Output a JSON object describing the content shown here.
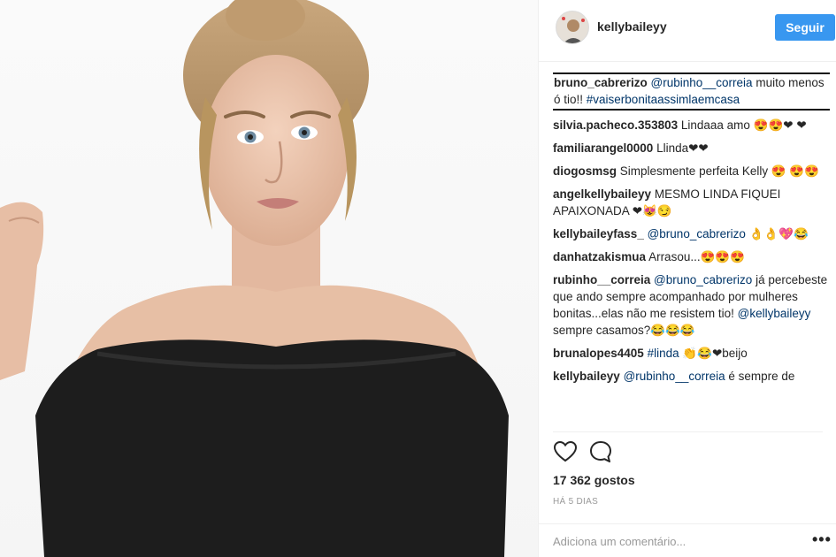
{
  "post": {
    "photo_alt": "Portrait photo",
    "author": {
      "username": "kellybaileyy",
      "follow_label": "Seguir"
    },
    "comments": [
      {
        "user": "bruno_cabrerizo",
        "parts": [
          {
            "type": "h",
            "text": "@rubinho__correia"
          },
          {
            "type": "t",
            "text": " muito menos ó tio!! "
          },
          {
            "type": "h",
            "text": "#vaiserbonitaassimlaemcasa"
          }
        ],
        "highlighted": true
      },
      {
        "user": "silvia.pacheco.353803",
        "parts": [
          {
            "type": "t",
            "text": "Lindaaa amo 😍😍❤ ❤"
          }
        ]
      },
      {
        "user": "familiarangel0000",
        "parts": [
          {
            "type": "t",
            "text": "Llinda❤❤"
          }
        ]
      },
      {
        "user": "diogosmsg",
        "parts": [
          {
            "type": "t",
            "text": "Simplesmente perfeita Kelly 😍 😍😍"
          }
        ]
      },
      {
        "user": "angelkellybaileyy",
        "parts": [
          {
            "type": "t",
            "text": "MESMO LINDA FIQUEI APAIXONADA ❤😻😏"
          }
        ]
      },
      {
        "user": "kellybaileyfass_",
        "parts": [
          {
            "type": "h",
            "text": "@bruno_cabrerizo"
          },
          {
            "type": "t",
            "text": " 👌👌💖😂"
          }
        ]
      },
      {
        "user": "danhatzakismua",
        "parts": [
          {
            "type": "t",
            "text": "Arrasou...😍😍😍"
          }
        ]
      },
      {
        "user": "rubinho__correia",
        "parts": [
          {
            "type": "h",
            "text": "@bruno_cabrerizo"
          },
          {
            "type": "t",
            "text": " já percebeste que ando sempre acompanhado por mulheres bonitas...elas não me resistem tio! "
          },
          {
            "type": "h",
            "text": "@kellybaileyy"
          },
          {
            "type": "t",
            "text": " sempre casamos?😂😂😂"
          }
        ]
      },
      {
        "user": "brunalopes4405",
        "parts": [
          {
            "type": "h",
            "text": "#linda"
          },
          {
            "type": "t",
            "text": " 👏😂❤beijo"
          }
        ]
      },
      {
        "user": "kellybaileyy",
        "parts": [
          {
            "type": "h",
            "text": "@rubinho__correia"
          },
          {
            "type": "t",
            "text": " é sempre de"
          }
        ]
      }
    ],
    "likes": "17 362 gostos",
    "date": "HÁ 5 DIAS",
    "add_comment_placeholder": "Adiciona um comentário...",
    "more_label": "•••"
  },
  "icons": [
    "heart-icon",
    "comment-icon",
    "more-options-icon"
  ],
  "colors": {
    "follow_button": "#3897f0",
    "link": "#003569",
    "muted": "#999999"
  }
}
